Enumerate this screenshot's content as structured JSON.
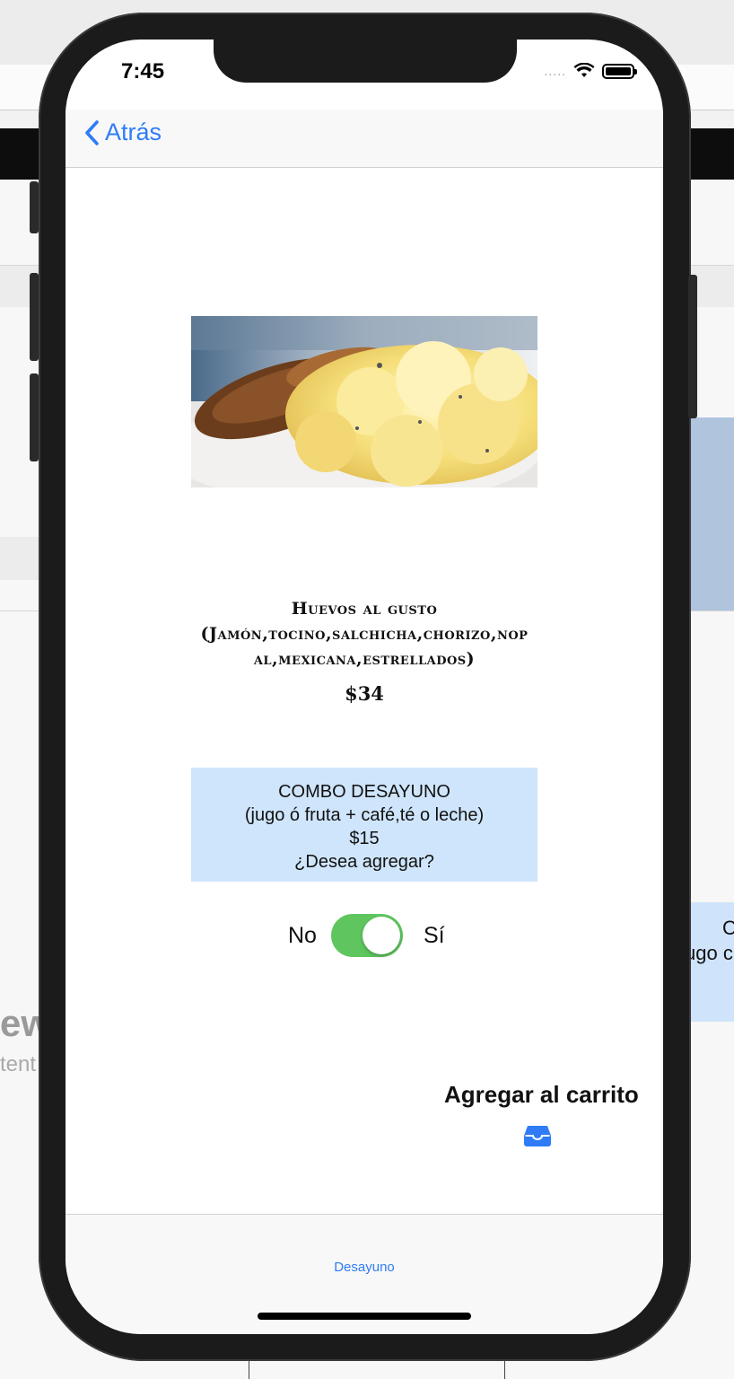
{
  "status_bar": {
    "time": "7:45",
    "signal": "....."
  },
  "nav": {
    "back_label": "Atrás"
  },
  "product": {
    "title_line1": "Huevos al gusto",
    "title_line2": "(Jamón,tocino,salchicha,chorizo,nop",
    "title_line3": "al,mexicana,estrellados)",
    "price": "$34"
  },
  "combo": {
    "line1": "COMBO DESAYUNO",
    "line2": "(jugo ó fruta + café,té o leche)",
    "line3": "$15",
    "line4": "¿Desea agregar?"
  },
  "toggle": {
    "label_off": "No",
    "label_on": "Sí",
    "on": true
  },
  "actions": {
    "add_to_cart": "Agregar al carrito"
  },
  "tabbar": {
    "tab1": "Desayuno"
  },
  "background": {
    "left_text1": "ew",
    "left_text2": "tent",
    "combo_text1": "C",
    "combo_text2": "ugo c"
  },
  "colors": {
    "accent": "#2f7cf6",
    "switch_on": "#5fc65f",
    "combo_bg": "#cfe5fb"
  }
}
